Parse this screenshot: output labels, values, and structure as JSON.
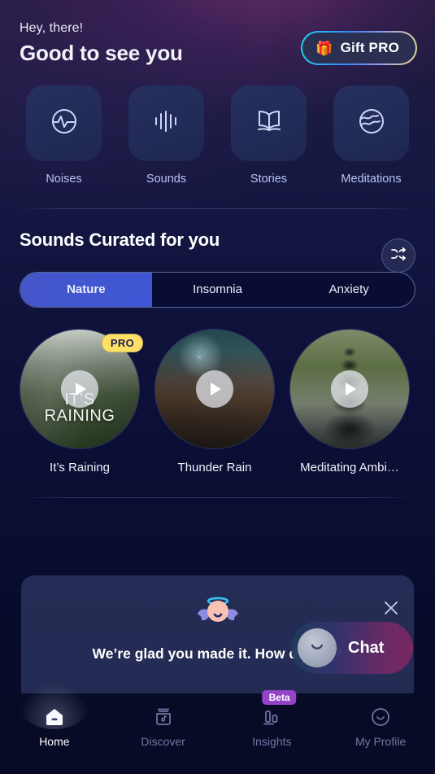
{
  "header": {
    "greeting": "Hey, there!",
    "title": "Good to see you",
    "gift_button": {
      "label": "Gift PRO",
      "icon": "gift-icon",
      "emoji": "🎁"
    }
  },
  "categories": [
    {
      "label": "Noises",
      "icon": "waveform-circle-icon"
    },
    {
      "label": "Sounds",
      "icon": "equalizer-bars-icon"
    },
    {
      "label": "Stories",
      "icon": "open-book-icon"
    },
    {
      "label": "Meditations",
      "icon": "wave-circle-icon"
    }
  ],
  "curated": {
    "title": "Sounds Curated for you",
    "shuffle_icon": "shuffle-icon",
    "tabs": [
      {
        "label": "Nature",
        "active": true
      },
      {
        "label": "Insomnia",
        "active": false
      },
      {
        "label": "Anxiety",
        "active": false
      }
    ],
    "cards": [
      {
        "name": "It’s Raining",
        "badge": "PRO",
        "overlay_line1": "IT’S",
        "overlay_line2": "RAINING",
        "art": "rainy-greenhouse",
        "play_icon": "play-icon"
      },
      {
        "name": "Thunder Rain",
        "badge": "",
        "overlay_line1": "",
        "overlay_line2": "",
        "art": "desert-lightning",
        "play_icon": "play-icon"
      },
      {
        "name": "Meditating Ambi…",
        "badge": "",
        "overlay_line1": "",
        "overlay_line2": "",
        "art": "zen-stones",
        "play_icon": "play-icon"
      }
    ]
  },
  "feedback": {
    "message": "We’re glad you made it. How d… far?",
    "mascot_icon": "angel-mascot-icon",
    "close_icon": "close-icon"
  },
  "chat": {
    "label": "Chat",
    "avatar_icon": "chat-avatar-icon"
  },
  "bottom_nav": [
    {
      "label": "Home",
      "icon": "home-icon",
      "active": true,
      "badge": ""
    },
    {
      "label": "Discover",
      "icon": "music-box-icon",
      "active": false,
      "badge": ""
    },
    {
      "label": "Insights",
      "icon": "bar-chart-icon",
      "active": false,
      "badge": "Beta"
    },
    {
      "label": "My Profile",
      "icon": "smiley-face-icon",
      "active": false,
      "badge": ""
    }
  ],
  "colors": {
    "accent_blue": "#3f57d6",
    "pro_yellow": "#ffe066",
    "beta_purple": "#9243c6",
    "background": "#0b0f30"
  }
}
